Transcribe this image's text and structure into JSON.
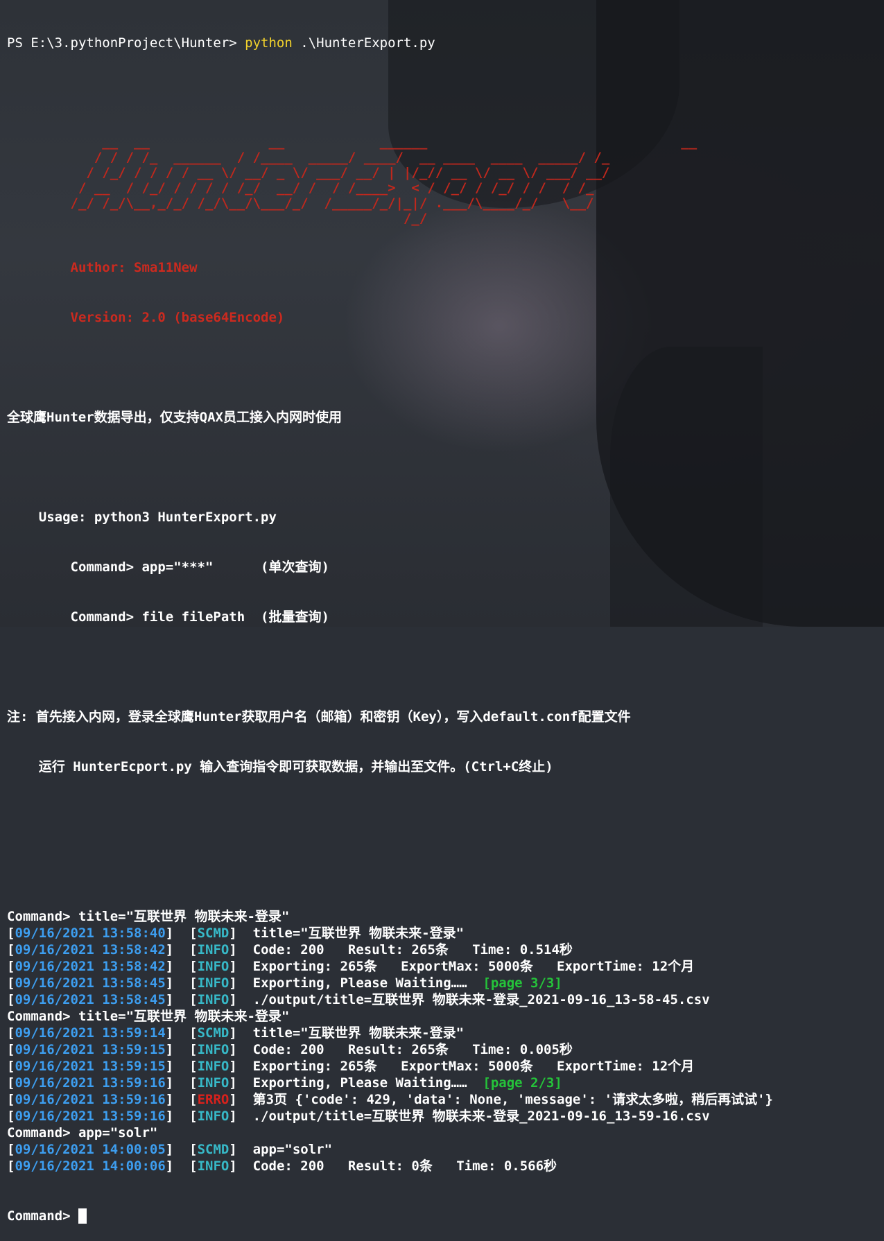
{
  "prompt_line": {
    "ps_prompt": "PS E:\\3.pythonProject\\Hunter> ",
    "cmd": "python",
    "args": " .\\HunterExport.py"
  },
  "banner": {
    "art": [
      "            __  __               __            ______                                __  ",
      "           / / / /_  ______  / /____  _____/ ____/  __ ____  ____  _____/ /_",
      "          / /_/ / / / / __ \\/ __/ _ \\/ ___/ __/ | |/_// __ \\/ __ \\/ ___/ __/",
      "         / __  / /_/ / / / / /_/  __/ /  / /____>  < / /_/ / /_/ / /  / /_  ",
      "        /_/ /_/\\__,_/_/ /_/\\__/\\___/_/  /_____/_/|_|/ .___/\\____/_/   \\__/  ",
      "                                                  /_/                        "
    ],
    "author": "        Author: Sma11New",
    "version": "        Version: 2.0 (base64Encode)"
  },
  "intro": {
    "description": "全球鹰Hunter数据导出，仅支持QAX员工接入内网时使用",
    "usage": "    Usage: python3 HunterExport.py",
    "usage_cmd1": "        Command> app=\"***\"      (单次查询)",
    "usage_cmd2": "        Command> file filePath  (批量查询)",
    "note1": "注: 首先接入内网，登录全球鹰Hunter获取用户名（邮箱）和密钥（Key），写入default.conf配置文件",
    "note2": "    运行 HunterEcport.py 输入查询指令即可获取数据，并输出至文件。(Ctrl+C终止)"
  },
  "session": [
    {
      "type": "command",
      "text": "Command> title=\"互联世界 物联未来-登录\""
    },
    {
      "type": "log",
      "time": "09/16/2021 13:58:40",
      "level": "SCMD",
      "msg": "title=\"互联世界 物联未来-登录\""
    },
    {
      "type": "log",
      "time": "09/16/2021 13:58:42",
      "level": "INFO",
      "msg": "Code: 200   Result: 265条   Time: 0.514秒"
    },
    {
      "type": "log",
      "time": "09/16/2021 13:58:42",
      "level": "INFO",
      "msg": "Exporting: 265条   ExportMax: 5000条   ExportTime: 12个月"
    },
    {
      "type": "log",
      "time": "09/16/2021 13:58:45",
      "level": "INFO",
      "msg": "Exporting, Please Waiting……  ",
      "extra": "[page 3/3]"
    },
    {
      "type": "log",
      "time": "09/16/2021 13:58:45",
      "level": "INFO",
      "msg": "./output/title=互联世界 物联未来-登录_2021-09-16_13-58-45.csv"
    },
    {
      "type": "command",
      "text": "Command> title=\"互联世界 物联未来-登录\""
    },
    {
      "type": "log",
      "time": "09/16/2021 13:59:14",
      "level": "SCMD",
      "msg": "title=\"互联世界 物联未来-登录\""
    },
    {
      "type": "log",
      "time": "09/16/2021 13:59:15",
      "level": "INFO",
      "msg": "Code: 200   Result: 265条   Time: 0.005秒"
    },
    {
      "type": "log",
      "time": "09/16/2021 13:59:15",
      "level": "INFO",
      "msg": "Exporting: 265条   ExportMax: 5000条   ExportTime: 12个月"
    },
    {
      "type": "log",
      "time": "09/16/2021 13:59:16",
      "level": "INFO",
      "msg": "Exporting, Please Waiting……  ",
      "extra": "[page 2/3]"
    },
    {
      "type": "log",
      "time": "09/16/2021 13:59:16",
      "level": "ERRO",
      "msg": "第3页 {'code': 429, 'data': None, 'message': '请求太多啦，稍后再试试'}"
    },
    {
      "type": "log",
      "time": "09/16/2021 13:59:16",
      "level": "INFO",
      "msg": "./output/title=互联世界 物联未来-登录_2021-09-16_13-59-16.csv"
    },
    {
      "type": "command",
      "text": "Command> app=\"solr\""
    },
    {
      "type": "log",
      "time": "09/16/2021 14:00:05",
      "level": "SCMD",
      "msg": "app=\"solr\""
    },
    {
      "type": "log",
      "time": "09/16/2021 14:00:06",
      "level": "INFO",
      "msg": "Code: 200   Result: 0条   Time: 0.566秒"
    }
  ],
  "final_prompt": "Command> ",
  "colors": {
    "banner_red": "#c0281d",
    "timestamp_blue": "#3d9ef0",
    "level_cyan": "#37b9c8",
    "page_green": "#25c33a",
    "error_red": "#d8211c",
    "python_yellow": "#f2d22c"
  }
}
